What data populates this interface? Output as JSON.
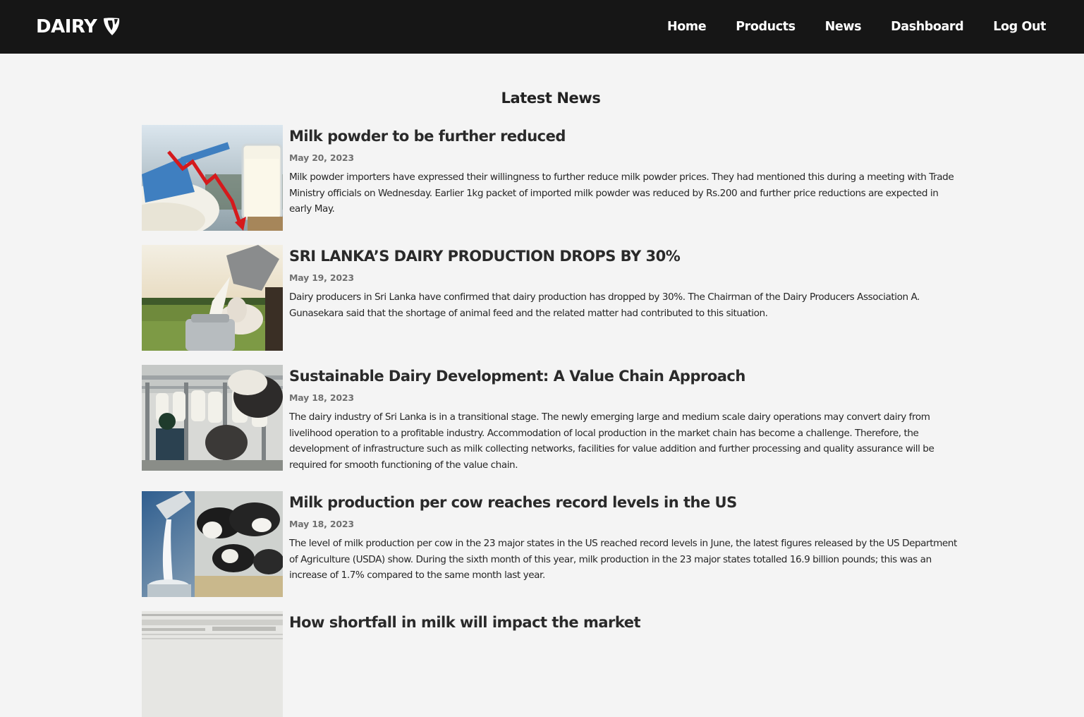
{
  "header": {
    "brand": "DAIRY",
    "logo_icon": "typo3-style-shield-icon",
    "nav": [
      "Home",
      "Products",
      "News",
      "Dashboard",
      "Log Out"
    ]
  },
  "main": {
    "title": "Latest News",
    "articles": [
      {
        "headline": "Milk powder to be further reduced",
        "date": "May 20, 2023",
        "summary": "Milk powder importers have expressed their willingness to further reduce milk powder prices. They had mentioned this during a meeting with Trade Ministry officials on Wednesday. Earlier 1kg packet of imported milk powder was reduced by Rs.200 and further price reductions are expected in early May.",
        "image": "milk-powder-price-drop-image"
      },
      {
        "headline": "SRI LANKA’S DAIRY PRODUCTION DROPS BY 30%",
        "date": "May 19, 2023",
        "summary": "Dairy producers in Sri Lanka have confirmed that dairy production has dropped by 30%. The Chairman of the Dairy Producers Association A. Gunasekara said that the shortage of animal feed and the related matter had contributed to this situation.",
        "image": "milk-can-pouring-field-image"
      },
      {
        "headline": "Sustainable Dairy Development: A Value Chain Approach",
        "date": "May 18, 2023",
        "summary": "The dairy industry of Sri Lanka is in a transitional stage. The newly emerging large and medium scale dairy operations may convert dairy from livelihood operation to a profitable industry. Accommodation of local production in the market chain has become a challenge. Therefore, the development of infrastructure such as milk collecting networks, facilities for value addition and further processing and quality assurance will be required for smooth functioning of the value chain.",
        "image": "milking-parlour-image"
      },
      {
        "headline": "Milk production per cow reaches record levels in the US",
        "date": "May 18, 2023",
        "summary": "The level of milk production per cow in the 23 major states in the US reached record levels in June, the latest figures released by the US Department of Agriculture (USDA) show. During the sixth month of this year, milk production in the 23 major states totalled 16.9 billion pounds; this was an increase of 1.7% compared to the same month last year.",
        "image": "cows-and-milk-pour-image"
      },
      {
        "headline": "How shortfall in milk will impact the market",
        "date": "",
        "summary": "",
        "image": "newspaper-clipping-image"
      }
    ]
  },
  "colors": {
    "topbar": "#161616",
    "page_bg": "#f4f4f4",
    "text": "#262626",
    "date": "#707070"
  }
}
